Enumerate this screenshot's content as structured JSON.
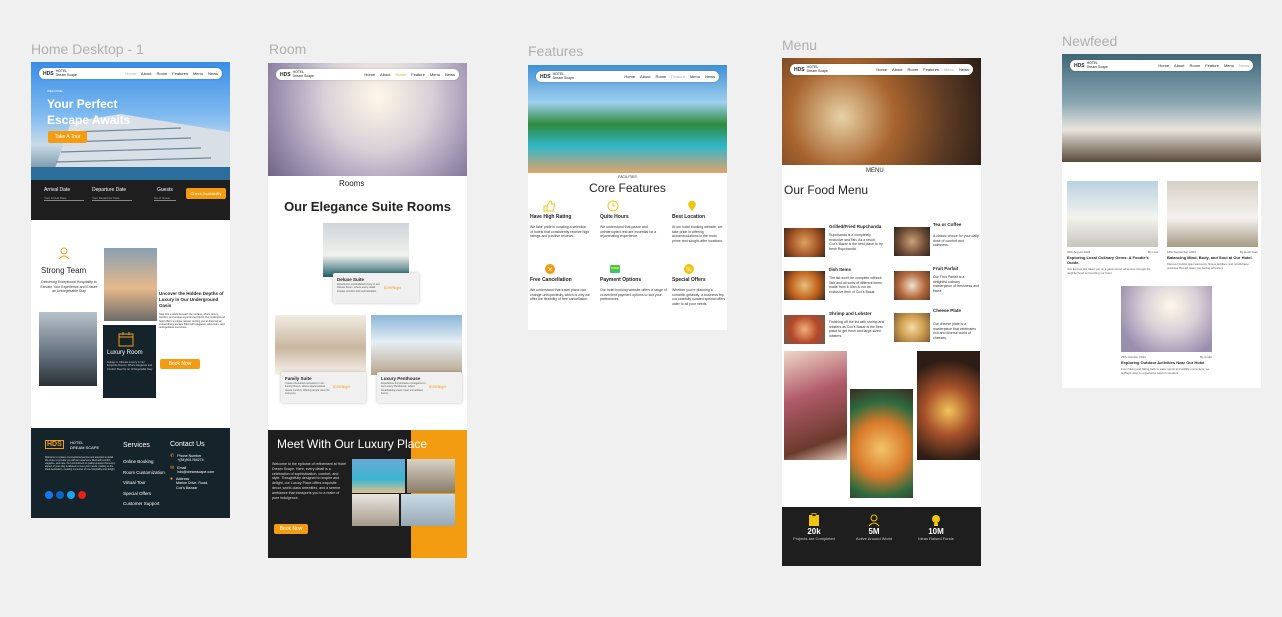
{
  "frames": {
    "home": {
      "title": "Home Desktop - 1",
      "nav": {
        "logo": "HDS",
        "logo_sub": "HOTEL Dream Scape",
        "links": [
          "Home",
          "About",
          "Room",
          "Features",
          "Menu",
          "News"
        ]
      },
      "hero": {
        "kicker": "WELCOME",
        "title_line1": "Your Perfect",
        "title_line2": "Escape Awaits",
        "cta": "Take A Tour"
      },
      "booking": {
        "arrival_label": "Arrival Date",
        "arrival_placeholder": "Your Arrival Date",
        "departure_label": "Departure Date",
        "departure_placeholder": "Your Departure Date",
        "guests_label": "Guests",
        "guests_placeholder": "No of Guest",
        "check_button": "Check Availability"
      },
      "team": {
        "title": "Strong Team",
        "desc": "Delivering Exceptional Hospitality to Elevate Your Experience and Ensure an Unforgettable Stay"
      },
      "discover": {
        "title": "Uncover the Hidden Depths of Luxury in Our Underground Oasis",
        "desc": "Step into a world beneath the surface, where luxury, comfort, and unique experiences blend. Our underground hotel offers a unique retreat, inviting you to discover an extraordinary escape filled with elegance, adventure, and unforgettable memories."
      },
      "luxury_room": {
        "title": "Luxury Room",
        "desc": "Indulge in Ultimate Luxury in Our Exquisite Rooms, Where Elegance and Comfort Meet for an Unforgettable Stay"
      },
      "book_now": "Book Now",
      "footer": {
        "logo": "HDS",
        "logo_sub1": "HOTEL",
        "logo_sub2": "DREAM SCAPE",
        "about": "Welcome to a place of exceptional service and attention to detail. We strive to provide you with an experience filled with comfort, elegance, and care. Our commitment to quality ensures that every aspect of your stay is tailored to meet your needs, making us the ideal destination, creating memories of true hospitality and delight.",
        "services_title": "Services",
        "services": [
          "Online Booking",
          "Room Customization",
          "Virtual Tour",
          "Special Offers",
          "Customer Support"
        ],
        "contact_title": "Contact Us",
        "phone_label": "Phone Number",
        "phone": "+(84)901764274",
        "email_label": "Email",
        "email": "hds@dreamscape.com",
        "address_label": "Address",
        "address_line1": "Marine Drive, Road,",
        "address_line2": "Cox's Bazaar"
      }
    },
    "room": {
      "title": "Room",
      "nav": {
        "logo": "HDS",
        "logo_sub": "HOTEL Dream Scape",
        "links": [
          "Home",
          "About",
          "Room",
          "Feature",
          "Menu",
          "News"
        ]
      },
      "section_label": "Rooms",
      "heading": "Our Elegance Suite Rooms",
      "cards": [
        {
          "name": "Deluxe Suite",
          "desc": "Experience unparalleled luxury in our Deluxe Room, where every detail exudes comfort and sophistication.",
          "price": "$199/Night"
        },
        {
          "name": "Family Suite",
          "desc": "Create cherished memories in our Family Room, where spaciousness meets comfort, offering ample room for everyone.",
          "price": "$199/Night"
        },
        {
          "name": "Luxury Penthouse",
          "desc": "Experience the pinnacle of elegance in our Luxury Penthouse, where breathtaking views meet unmatched luxury.",
          "price": "$199/Night"
        }
      ],
      "promo": {
        "title_prefix": "Meet With Our Luxury ",
        "title_highlight": "Place",
        "desc": "Welcome to the epitome of refinement at Hotel Dream Scape. Here, every detail is a celebration of sophistication, comfort, and style. Thoughtfully designed to inspire and delight, our Luxury Place offers exquisite decor, world-class amenities, and a serene ambiance that transports you to a realm of pure indulgence.",
        "cta": "Book Now"
      }
    },
    "features": {
      "title": "Features",
      "nav": {
        "logo": "HDS",
        "logo_sub": "HOTEL Dream Scape",
        "links": [
          "Home",
          "About",
          "Room",
          "Feature",
          "Menu",
          "News"
        ]
      },
      "section_label": "FACILITIES",
      "heading": "Core Features",
      "items": [
        {
          "title": "Have High Rating",
          "desc": "We take pride in curating a selection of hotels that consistently receive high ratings and positive reviews."
        },
        {
          "title": "Quite Hours",
          "desc": "We understand that peace and uninterrupted rest are essential for a rejuvenating experience."
        },
        {
          "title": "Best Location",
          "desc": "At our hotel booking website, we take pride in offering accommodations in the most prime and sought-after locations."
        },
        {
          "title": "Free Cancellation",
          "desc": "We understand that travel plans can change unexpectedly, which is why we offer the flexibility of free cancellation."
        },
        {
          "title": "Payment Options",
          "desc": "Our hotel booking website offers a range of convenient payment options to suit your preferences."
        },
        {
          "title": "Special Offers",
          "desc": "Whether you're planning a romantic getaway, a business trip, our carefully curated special offers cater to all your needs."
        }
      ]
    },
    "menu": {
      "title": "Menu",
      "nav": {
        "logo": "HDS",
        "logo_sub": "HOTEL Dream Scape",
        "links": [
          "Home",
          "About",
          "Room",
          "Features",
          "Menu",
          "News"
        ]
      },
      "section_label": "MENU",
      "heading": "Our Food Menu",
      "items": [
        {
          "name": "Grilled/Fried Rupchanda",
          "desc": "Rupchanda is a completely exclusive sea fish. As a result, Cox's Bazar is the best place to try fresh Rupchanda."
        },
        {
          "name": "Tea or Coffee",
          "desc": "A classic choice for your daily dose of comfort and calmness."
        },
        {
          "name": "Ilish Items",
          "desc": "The list won't be complete without Ilish and all sorts of different items made from it. Ilish is not an exclusive item of Cox's Bazar."
        },
        {
          "name": "Fruit Parfait",
          "desc": "Our Fruit Parfait is a delightful culinary masterpiece of freshness and flavor."
        },
        {
          "name": "Shrimp and Lobster",
          "desc": "Finishing off the list with shrimp and lobsters as Cox's Bazar is the best place to get fresh and large-sized lobsters."
        },
        {
          "name": "Cheese Plate",
          "desc": "Our cheese plate is a masterpiece that celebrates rich and diverse world of cheeses."
        }
      ],
      "stats": [
        {
          "value": "20k",
          "label": "Projects are Completed"
        },
        {
          "value": "5M",
          "label": "Active Around World"
        },
        {
          "value": "10M",
          "label": "Ideas Raised Funds"
        }
      ]
    },
    "newfeed": {
      "title": "Newfeed",
      "nav": {
        "logo": "HDS",
        "logo_sub": "HOTEL Dream Scape",
        "links": [
          "Home",
          "About",
          "Room",
          "Feature",
          "Menu",
          "News"
        ]
      },
      "posts": [
        {
          "date": "20th August 2024",
          "author": "By Lina",
          "title": "Exploring Local Culinary Gems: A Foodie's Guide.",
          "desc": "Join Emil as she takes you on a gastronomic adventure through the neighborhood surrounding our hotel."
        },
        {
          "date": "16th September 2024",
          "author": "By Emilt Iwan",
          "title": "Balancing Mind, Body, and Soul at Our Hotel.",
          "desc": "Discover holistic spa treatments, fitness facilities, and mindfulness practices that will leave you feeling refreshed."
        },
        {
          "date": "25th October 2024",
          "author": "By Andut",
          "title": "Exploring Outdoor Activities Near Our Hotel",
          "desc": "From hiking and biking trails to water sports and wildlife encounters, we highlight ways to experience nature's wonders."
        }
      ]
    }
  },
  "colors": {
    "accent": "#f39c12",
    "dark": "#1e1e1e",
    "navy": "#15232b",
    "canvas": "#f0f0f0"
  }
}
